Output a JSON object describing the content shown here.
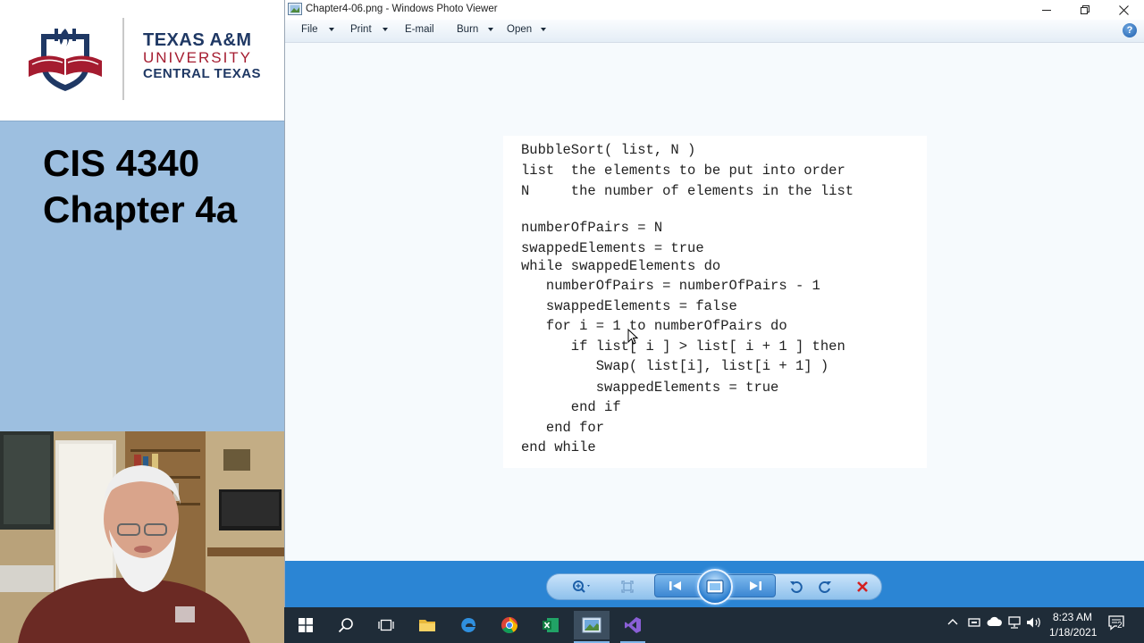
{
  "slide": {
    "logo": {
      "line1": "TEXAS A&M",
      "line2": "UNIVERSITY",
      "line3": "CENTRAL TEXAS"
    },
    "title_line1": "CIS 4340",
    "title_line2": "Chapter 4a"
  },
  "viewer": {
    "window_title": "Chapter4-06.png - Windows Photo Viewer",
    "window_controls": [
      "minimize-icon",
      "restore-icon",
      "close-icon"
    ],
    "menu": [
      {
        "label": "File",
        "has_dropdown": true
      },
      {
        "label": "Print",
        "has_dropdown": true
      },
      {
        "label": "E-mail",
        "has_dropdown": false
      },
      {
        "label": "Burn",
        "has_dropdown": true
      },
      {
        "label": "Open",
        "has_dropdown": true
      }
    ],
    "help_label": "?",
    "code_lines": [
      "BubbleSort( list, N )",
      "list  the elements to be put into order",
      "N     the number of elements in the list",
      "numberOfPairs = N",
      "swappedElements = true",
      "while swappedElements do",
      "   numberOfPairs = numberOfPairs - 1",
      "   swappedElements = false",
      "   for i = 1 to numberOfPairs do",
      "      if list[ i ] > list[ i + 1 ] then",
      "         Swap( list[i], list[i + 1] )",
      "         swappedElements = true",
      "      end if",
      "   end for",
      "end while"
    ],
    "toolbar_icons": [
      "zoom-icon",
      "fit-window-icon",
      "previous-icon",
      "slideshow-icon",
      "next-icon",
      "rotate-counterclockwise-icon",
      "rotate-clockwise-icon",
      "delete-icon"
    ]
  },
  "taskbar": {
    "pinned": [
      "windows-start-icon",
      "search-icon",
      "task-view-icon",
      "file-explorer-icon",
      "edge-icon",
      "chrome-icon",
      "excel-icon",
      "photo-viewer-icon",
      "visual-studio-icon"
    ],
    "clock_time": "8:23 AM",
    "clock_date": "1/18/2021",
    "notification_count": "2"
  },
  "colors": {
    "slide_blue": "#9dbfe0",
    "viewer_bar_blue": "#2b85d4",
    "taskbar": "#1f2c38",
    "brand_maroon": "#a51c30",
    "brand_navy": "#1f3864"
  }
}
